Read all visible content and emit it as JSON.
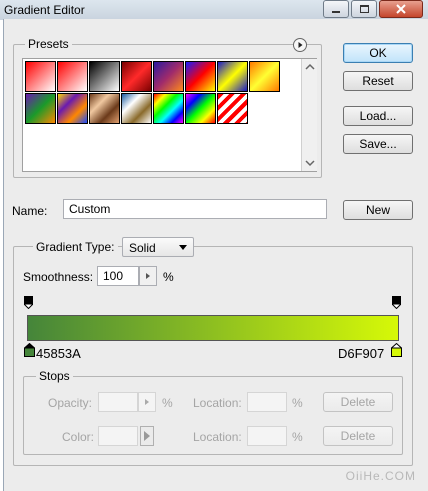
{
  "window": {
    "title": "Gradient Editor"
  },
  "presets": {
    "label": "Presets",
    "swatches": [
      {
        "name": "foreground-to-background",
        "css": "linear-gradient(135deg,#ff0000,#ffffff)"
      },
      {
        "name": "foreground-to-transparent",
        "css": "linear-gradient(135deg,#ff0000,rgba(255,0,0,0))"
      },
      {
        "name": "black-white",
        "css": "linear-gradient(135deg,#000000,#ffffff)"
      },
      {
        "name": "red-dark",
        "css": "linear-gradient(135deg,#7a0000,#ff2a2a,#7a0000)"
      },
      {
        "name": "violet-orange",
        "css": "linear-gradient(135deg,#2b1aa0,#a02b6b,#ff8c1a)"
      },
      {
        "name": "blue-red-yellow",
        "css": "linear-gradient(135deg,#1a1aff,#ff0000,#ffff00)"
      },
      {
        "name": "blue-yellow-blue",
        "css": "linear-gradient(135deg,#1a1ac8,#ffff00,#1a1ac8)"
      },
      {
        "name": "orange-yellow-orange",
        "css": "linear-gradient(135deg,#ff7a00,#ffff33,#ff7a00)"
      },
      {
        "name": "violet-green-orange",
        "css": "linear-gradient(135deg,#6a1ab0,#1a9a2a,#ff8800)"
      },
      {
        "name": "yellow-violet-orange-blue",
        "css": "linear-gradient(135deg,#ffd800,#6a1ab0,#ff8800,#1a4aff)"
      },
      {
        "name": "copper",
        "css": "linear-gradient(135deg,#6b3a1a,#f0c8a0,#6b3a1a,#e0a070)"
      },
      {
        "name": "chrome",
        "css": "linear-gradient(135deg,#1a5aa0,#ffffff,#8a6a2a,#ffffff)"
      },
      {
        "name": "spectrum",
        "css": "linear-gradient(135deg,#ff0000,#ffff00,#00ff00,#00ffff,#0000ff,#ff00ff)"
      },
      {
        "name": "transparent-rainbow",
        "css": "linear-gradient(135deg,#ff00ff,#0000ff,#00ff00,#ffff00,#ff0000)"
      },
      {
        "name": "transparent-stripes",
        "css": "repeating-linear-gradient(135deg,#ff0000 0 4px,#ffffff 4px 8px)"
      }
    ]
  },
  "buttons": {
    "ok": "OK",
    "reset": "Reset",
    "load": "Load...",
    "save": "Save...",
    "new": "New"
  },
  "name_field": {
    "label": "Name:",
    "value": "Custom"
  },
  "gradient_type": {
    "label": "Gradient Type:",
    "value": "Solid"
  },
  "smoothness": {
    "label": "Smoothness:",
    "value": "100",
    "unit": "%"
  },
  "gradient": {
    "start_color": "#45853A",
    "end_color": "#D6F907",
    "start_label": "45853A",
    "end_label": "D6F907"
  },
  "stops": {
    "label": "Stops",
    "opacity_label": "Opacity:",
    "opacity_unit": "%",
    "color_label": "Color:",
    "location_label": "Location:",
    "location_unit": "%",
    "delete_label": "Delete"
  },
  "watermark": "OiiHe.COM"
}
